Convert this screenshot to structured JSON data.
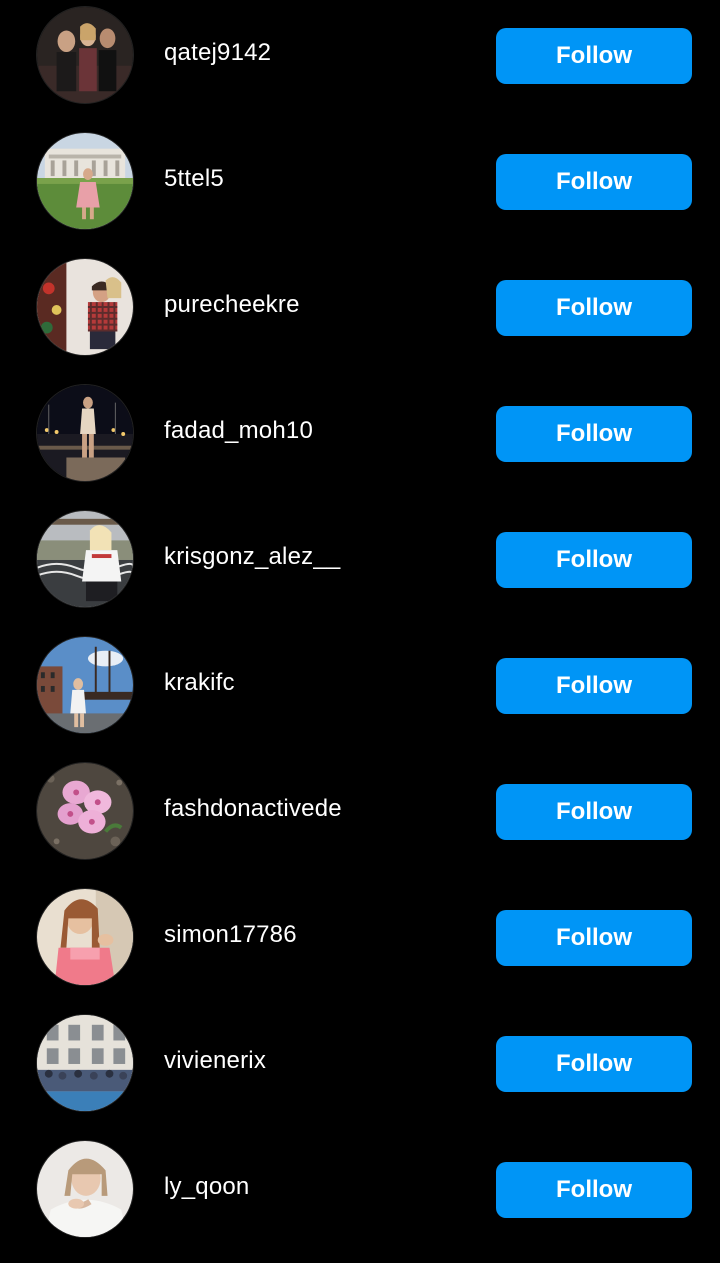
{
  "follow_label": "Follow",
  "accent_color": "#0095f6",
  "suggestions": [
    {
      "username": "qatej9142",
      "avatar": "group-photo-avatar"
    },
    {
      "username": "5ttel5",
      "avatar": "monument-lawn-avatar"
    },
    {
      "username": "purecheekre",
      "avatar": "couple-christmas-avatar"
    },
    {
      "username": "fadad_moh10",
      "avatar": "night-harbor-avatar"
    },
    {
      "username": "krisgonz_alez__",
      "avatar": "bridge-river-avatar"
    },
    {
      "username": "krakifc",
      "avatar": "ship-quay-avatar"
    },
    {
      "username": "fashdonactivede",
      "avatar": "pink-flower-avatar"
    },
    {
      "username": "simon17786",
      "avatar": "selfie-avatar"
    },
    {
      "username": "vivienerix",
      "avatar": "crowd-building-avatar"
    },
    {
      "username": "ly_qoon",
      "avatar": "portrait-white-sweater-avatar"
    }
  ]
}
